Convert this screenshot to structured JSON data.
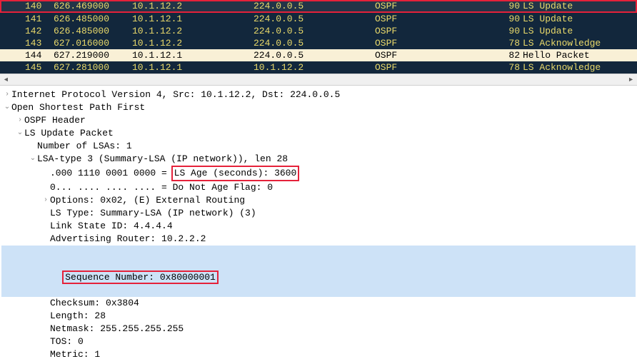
{
  "packet_list": {
    "rows": [
      {
        "no": "140",
        "time": "626.469000",
        "src": "10.1.12.2",
        "dst": "224.0.0.5",
        "prot": "OSPF",
        "len": "90",
        "info": "LS Update",
        "style": "highlight-red"
      },
      {
        "no": "141",
        "time": "626.485000",
        "src": "10.1.12.1",
        "dst": "224.0.0.5",
        "prot": "OSPF",
        "len": "90",
        "info": "LS Update",
        "style": ""
      },
      {
        "no": "142",
        "time": "626.485000",
        "src": "10.1.12.2",
        "dst": "224.0.0.5",
        "prot": "OSPF",
        "len": "90",
        "info": "LS Update",
        "style": ""
      },
      {
        "no": "143",
        "time": "627.016000",
        "src": "10.1.12.2",
        "dst": "224.0.0.5",
        "prot": "OSPF",
        "len": "78",
        "info": "LS Acknowledge",
        "style": ""
      },
      {
        "no": "144",
        "time": "627.219000",
        "src": "10.1.12.1",
        "dst": "224.0.0.5",
        "prot": "OSPF",
        "len": "82",
        "info": "Hello Packet",
        "style": "beige"
      },
      {
        "no": "145",
        "time": "627.281000",
        "src": "10.1.12.1",
        "dst": "10.1.12.2",
        "prot": "OSPF",
        "len": "78",
        "info": "LS Acknowledge",
        "style": ""
      }
    ]
  },
  "details": {
    "ip_line": "Internet Protocol Version 4, Src: 10.1.12.2, Dst: 224.0.0.5",
    "ospf_line": "Open Shortest Path First",
    "ospf_header": "OSPF Header",
    "ls_update_packet": "LS Update Packet",
    "num_lsas": "Number of LSAs: 1",
    "lsa_type3": "LSA-type 3 (Summary-LSA (IP network)), len 28",
    "ls_age_bits": ".000 1110 0001 0000 = ",
    "ls_age_val": "LS Age (seconds): 3600",
    "do_not_age": "0... .... .... .... = Do Not Age Flag: 0",
    "options": "Options: 0x02, (E) External Routing",
    "ls_type": "LS Type: Summary-LSA (IP network) (3)",
    "link_state_id": "Link State ID: 4.4.4.4",
    "adv_router": "Advertising Router: 10.2.2.2",
    "seq_num": "Sequence Number: 0x80000001",
    "checksum": "Checksum: 0x3804",
    "length": "Length: 28",
    "netmask": "Netmask: 255.255.255.255",
    "tos": "TOS: 0",
    "metric": "Metric: 1"
  }
}
